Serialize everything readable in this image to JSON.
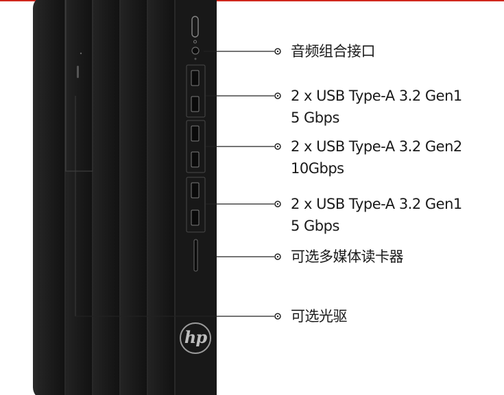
{
  "callouts": [
    {
      "id": "audio",
      "line1": "音频组合接口",
      "line2": ""
    },
    {
      "id": "usb1",
      "line1": "2 x USB  Type-A 3.2 Gen1",
      "line2": "5 Gbps"
    },
    {
      "id": "usb2",
      "line1": "2 x USB  Type-A 3.2 Gen2",
      "line2": "10Gbps"
    },
    {
      "id": "usb3",
      "line1": "2 x USB  Type-A 3.2 Gen1",
      "line2": "5 Gbps"
    },
    {
      "id": "card",
      "line1": "可选多媒体读卡器",
      "line2": ""
    },
    {
      "id": "odd",
      "line1": "可选光驱",
      "line2": ""
    }
  ],
  "logo": {
    "text": "hp"
  },
  "colors": {
    "accent": "#d0281e",
    "case": "#141414",
    "panel": "#1c1c1c"
  }
}
